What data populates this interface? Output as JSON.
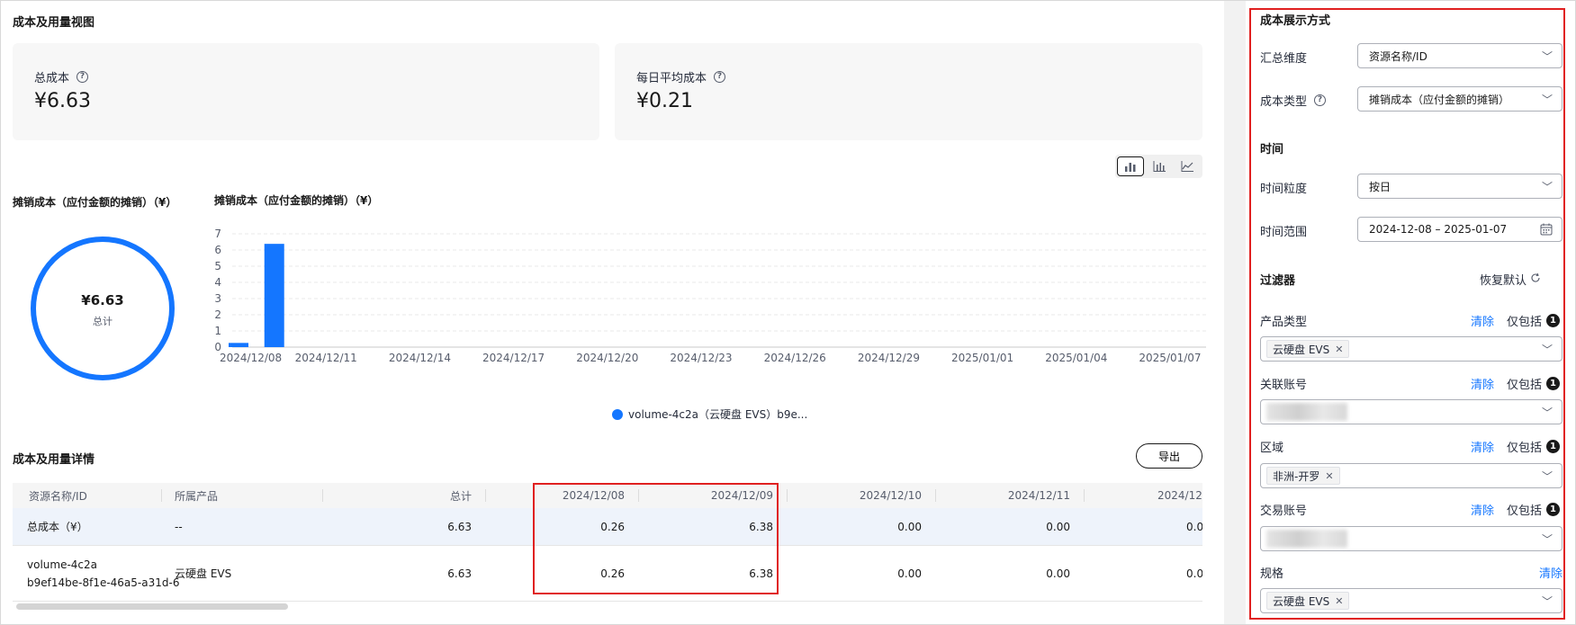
{
  "page": {
    "title": "成本及用量视图"
  },
  "cards": [
    {
      "label": "总成本",
      "value": "¥6.63"
    },
    {
      "label": "每日平均成本",
      "value": "¥0.21"
    }
  ],
  "donut": {
    "title": "摊销成本（应付金额的摊销）（¥）",
    "value": "¥6.63",
    "label": "总计",
    "color": "#1476ff"
  },
  "chart_data": {
    "type": "bar",
    "title": "摊销成本（应付金额的摊销）（¥）",
    "x_ticks": [
      "2024/12/08",
      "2024/12/11",
      "2024/12/14",
      "2024/12/17",
      "2024/12/20",
      "2024/12/23",
      "2024/12/26",
      "2024/12/29",
      "2025/01/01",
      "2025/01/04",
      "2025/01/07"
    ],
    "y_ticks": [
      0,
      1,
      2,
      3,
      4,
      5,
      6,
      7
    ],
    "ylim": [
      0,
      7
    ],
    "grid": true,
    "series": [
      {
        "name": "volume-4c2a（云硬盘 EVS）b9e...",
        "color": "#1476ff",
        "x": [
          "2024/12/08",
          "2024/12/09"
        ],
        "values": [
          0.26,
          6.38
        ]
      }
    ],
    "legend": "bottom-center"
  },
  "detail": {
    "title": "成本及用量详情",
    "export_label": "导出",
    "columns": [
      "资源名称/ID",
      "所属产品",
      "总计",
      "2024/12/08",
      "2024/12/09",
      "2024/12/10",
      "2024/12/11",
      "2024/12/"
    ],
    "rows": [
      {
        "name": "总成本（¥）",
        "name2": "",
        "product": "--",
        "total": "6.63",
        "d08": "0.26",
        "d09": "6.38",
        "d10": "0.00",
        "d11": "0.00",
        "d12": "0.0"
      },
      {
        "name": "volume-4c2a",
        "name2": "b9ef14be-8f1e-46a5-a31d-6",
        "product": "云硬盘 EVS",
        "total": "6.63",
        "d08": "0.26",
        "d09": "6.38",
        "d10": "0.00",
        "d11": "0.00",
        "d12": "0.0"
      }
    ]
  },
  "panel": {
    "display_title": "成本展示方式",
    "summary_label": "汇总维度",
    "summary_value": "资源名称/ID",
    "cost_type_label": "成本类型",
    "cost_type_value": "摊销成本（应付金额的摊销）",
    "time_title": "时间",
    "granularity_label": "时间粒度",
    "granularity_value": "按日",
    "range_label": "时间范围",
    "range_value": "2024-12-08 – 2025-01-07",
    "filter_title": "过滤器",
    "restore_label": "恢复默认",
    "clear_label": "清除",
    "only_label": "仅包括",
    "filters": [
      {
        "label": "产品类型",
        "tag": "云硬盘 EVS",
        "count": "1"
      },
      {
        "label": "关联账号",
        "tag": "",
        "count": "1"
      },
      {
        "label": "区域",
        "tag": "非洲-开罗",
        "count": "1"
      },
      {
        "label": "交易账号",
        "tag": "",
        "count": "1"
      },
      {
        "label": "规格",
        "tag": "云硬盘 EVS",
        "count": ""
      }
    ]
  }
}
